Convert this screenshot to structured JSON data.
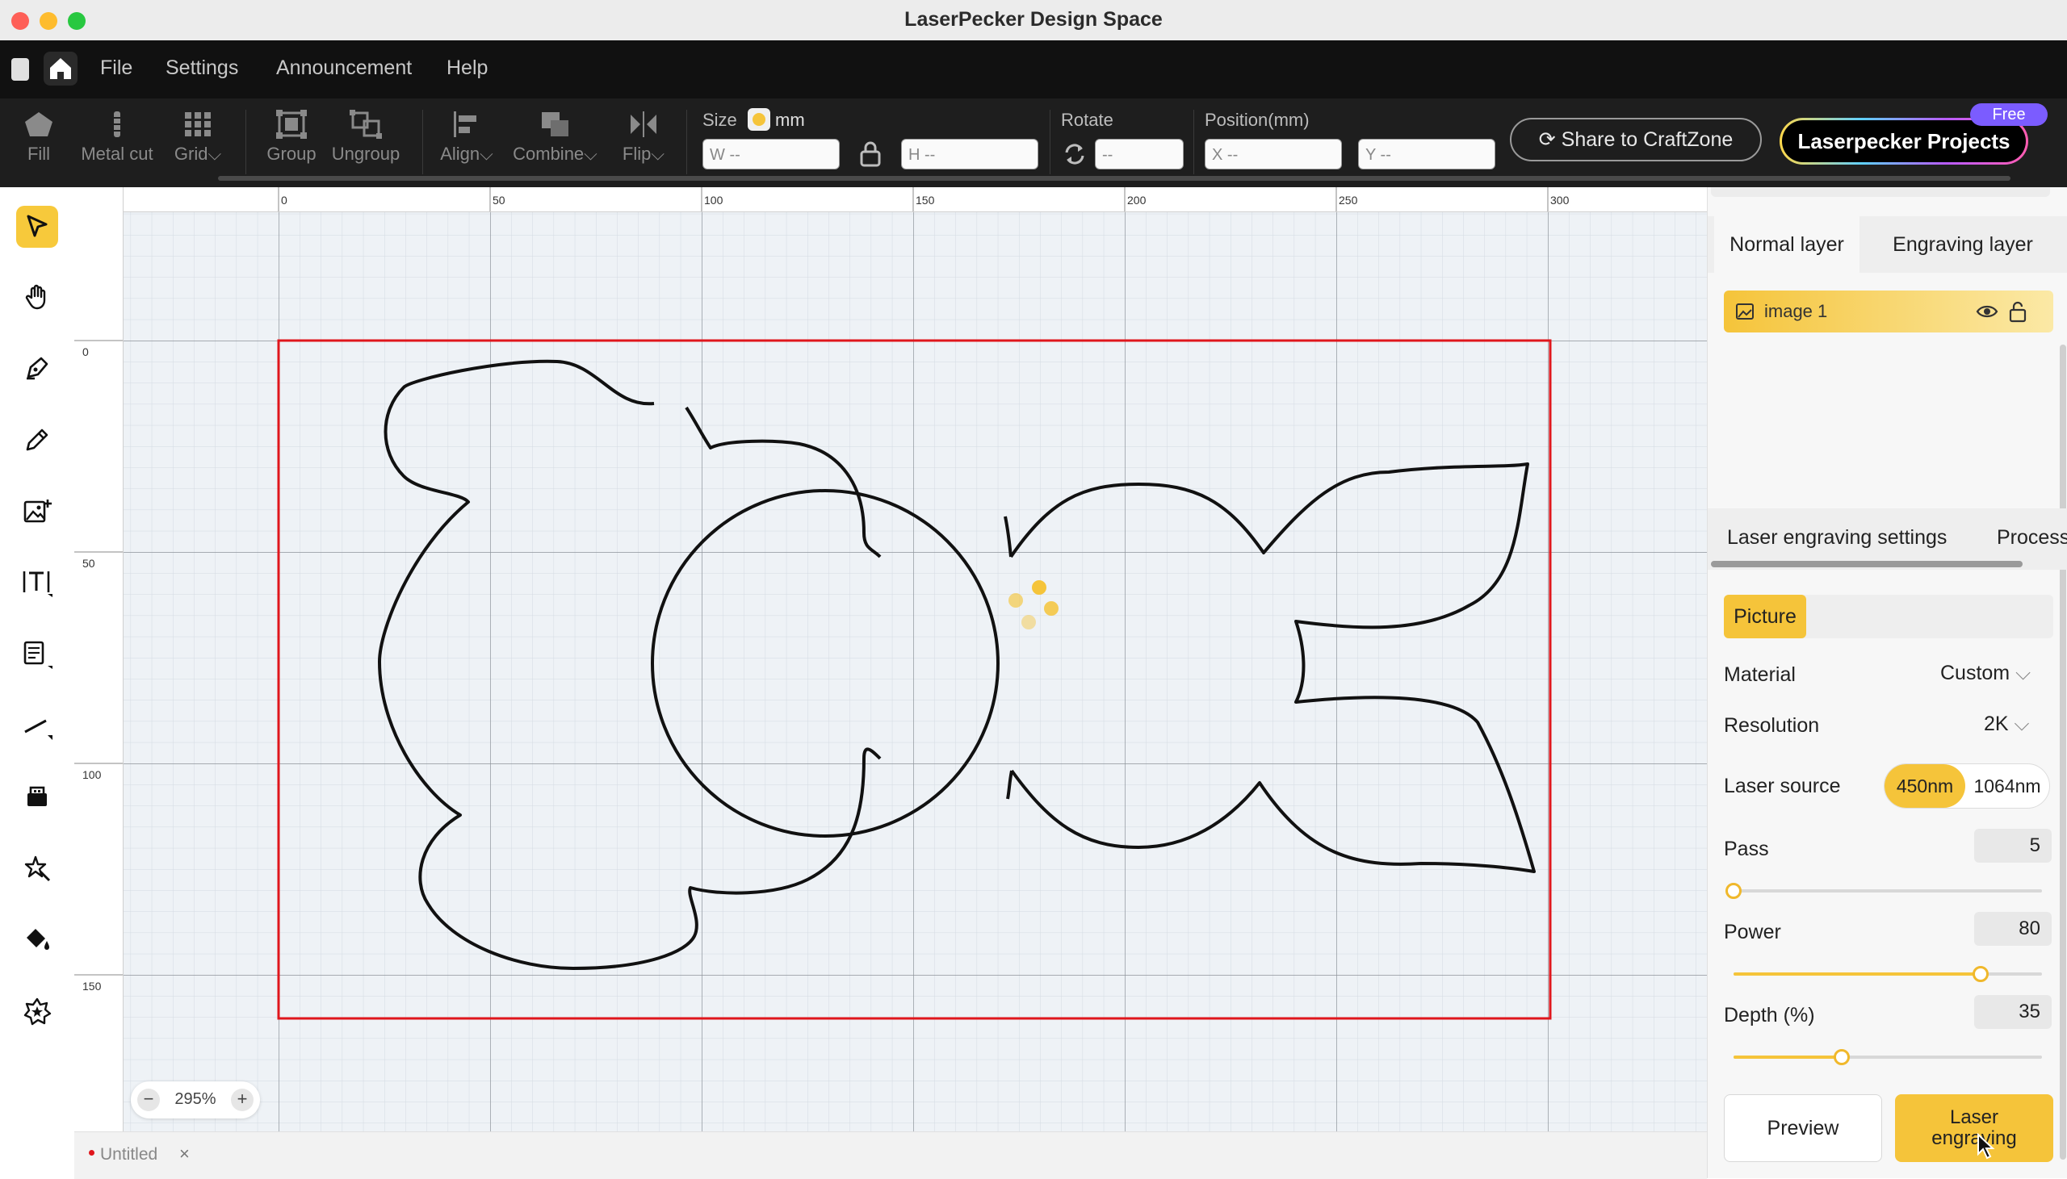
{
  "window": {
    "title": "LaserPecker Design Space"
  },
  "menu": [
    "File",
    "Settings",
    "Announcement",
    "Help"
  ],
  "toolbar": {
    "tools": [
      {
        "label": "Fill",
        "icon": "fill-icon"
      },
      {
        "label": "Metal cut",
        "icon": "metal-cut-icon"
      },
      {
        "label": "Grid",
        "icon": "grid-icon",
        "caret": "⌵"
      },
      {
        "label": "Group",
        "icon": "group-icon"
      },
      {
        "label": "Ungroup",
        "icon": "ungroup-icon"
      },
      {
        "label": "Align",
        "icon": "align-icon",
        "caret": "⌵"
      },
      {
        "label": "Combine",
        "icon": "combine-icon",
        "caret": "⌵"
      },
      {
        "label": "Flip",
        "icon": "flip-icon",
        "caret": "⌵"
      }
    ],
    "size_label": "Size",
    "unit": "mm",
    "width_prefix": "W",
    "width_placeholder": "--",
    "height_prefix": "H",
    "height_placeholder": "--",
    "rotate_label": "Rotate",
    "rotate_placeholder": "--",
    "position_label": "Position(mm)",
    "x_prefix": "X",
    "x_placeholder": "--",
    "y_prefix": "Y",
    "y_placeholder": "--",
    "share_label": "Share to CraftZone",
    "projects_label": "Laserpecker Projects",
    "free_badge": "Free"
  },
  "left_tools": [
    "select-tool-icon",
    "hand-tool-icon",
    "pen-tool-icon",
    "pencil-tool-icon",
    "add-image-icon",
    "text-tool-icon",
    "table-tool-icon",
    "line-tool-icon",
    "usb-tool-icon",
    "magic-tool-icon",
    "paint-bucket-icon",
    "star-sticker-icon"
  ],
  "canvas": {
    "ruler_top": [
      "0",
      "50",
      "100",
      "150",
      "200",
      "250",
      "300"
    ],
    "ruler_left": [
      "0",
      "50",
      "100",
      "150"
    ],
    "zoom": "295%"
  },
  "document_tab": {
    "name": "Untitled"
  },
  "layers": {
    "tabs": [
      "Normal layer",
      "Engraving layer"
    ],
    "items": [
      {
        "name": "image 1"
      }
    ]
  },
  "settings": {
    "tabs": [
      "Laser engraving settings",
      "Process"
    ],
    "mode": "Picture",
    "material_label": "Material",
    "material_value": "Custom",
    "resolution_label": "Resolution",
    "resolution_value": "2K",
    "laser_source_label": "Laser source",
    "laser_sources": [
      "450nm",
      "1064nm"
    ],
    "pass_label": "Pass",
    "pass_value": "5",
    "pass_fraction": 0.0,
    "power_label": "Power",
    "power_value": "80",
    "power_fraction": 0.8,
    "depth_label": "Depth (%)",
    "depth_value": "35",
    "depth_fraction": 0.35,
    "preview_label": "Preview",
    "engrave_label": "Laser engraving"
  },
  "colors": {
    "accent": "#f5c43a",
    "artboard_border": "#e0161c",
    "menu_bg": "#111111",
    "toolbar_bg": "#1e1e1e"
  }
}
